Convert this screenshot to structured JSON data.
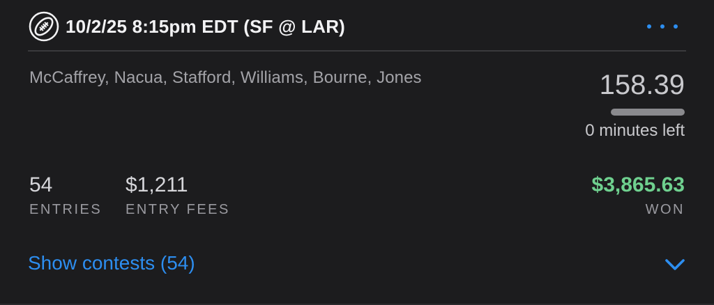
{
  "header": {
    "title": "10/2/25 8:15pm EDT (SF @ LAR)",
    "sport_icon": "football-icon",
    "more_icon": "more-dots-icon"
  },
  "lineup": {
    "players": "McCaffrey, Nacua, Stafford, Williams, Bourne, Jones"
  },
  "score": {
    "points": "158.39",
    "time_left": "0 minutes left",
    "progress_fraction": 1.0
  },
  "stats": {
    "entries_value": "54",
    "entries_label": "ENTRIES",
    "fees_value": "$1,211",
    "fees_label": "ENTRY FEES",
    "won_value": "$3,865.63",
    "won_label": "WON"
  },
  "footer": {
    "show_contests_label": "Show contests (54)",
    "expand_icon": "chevron-down-icon"
  },
  "colors": {
    "accent": "#2d8ef0",
    "won": "#6fd08f",
    "background": "#1c1c1e"
  }
}
